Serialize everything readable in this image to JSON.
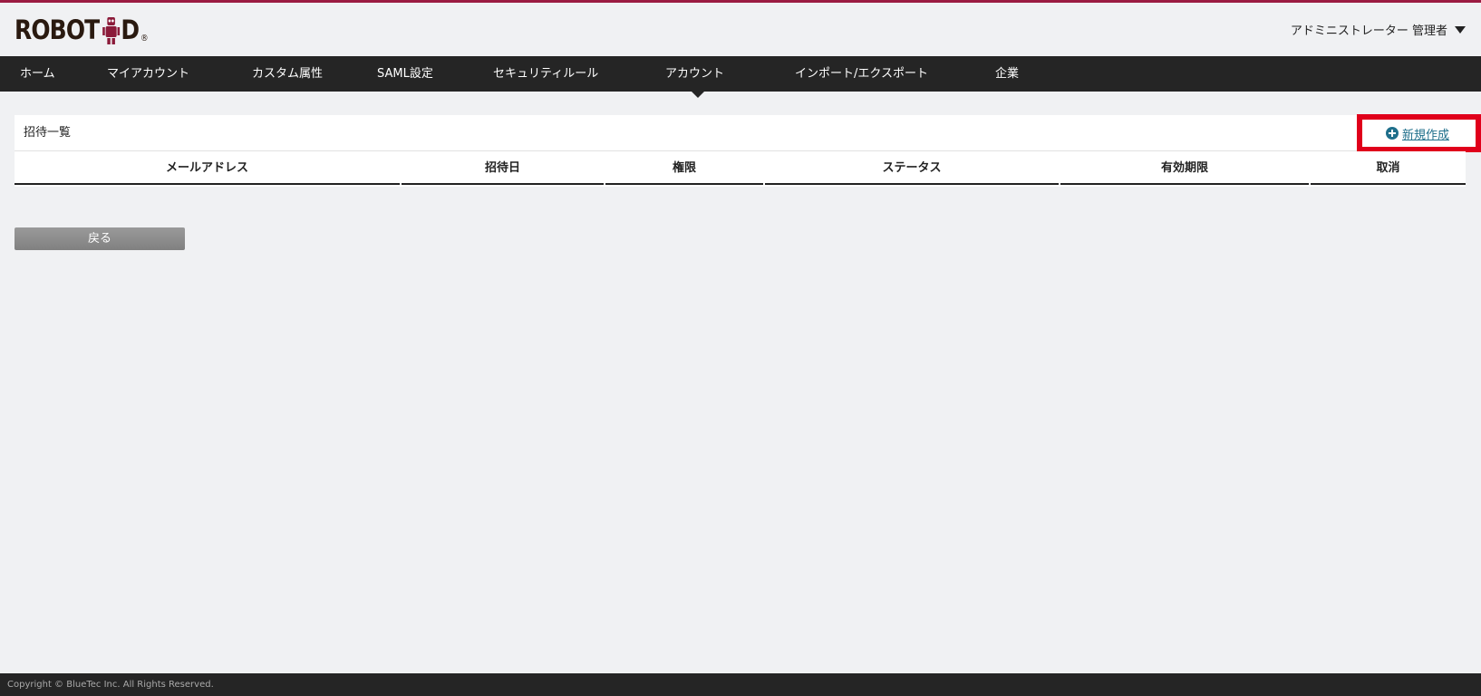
{
  "header": {
    "logo_text_left": "ROBOT",
    "logo_text_right": "D",
    "logo_reg": "®",
    "user_name": "アドミニストレーター 管理者"
  },
  "nav": {
    "items": [
      {
        "label": "ホーム"
      },
      {
        "label": "マイアカウント"
      },
      {
        "label": "カスタム属性"
      },
      {
        "label": "SAML設定"
      },
      {
        "label": "セキュリティルール"
      },
      {
        "label": "アカウント",
        "active": true
      },
      {
        "label": "インポート/エクスポート"
      },
      {
        "label": "企業"
      }
    ]
  },
  "panel": {
    "title": "招待一覧",
    "new_button_label": "新規作成"
  },
  "table": {
    "columns": [
      "メールアドレス",
      "招待日",
      "権限",
      "ステータス",
      "有効期限",
      "取消"
    ],
    "rows": []
  },
  "back_button_label": "戻る",
  "footer": {
    "copyright": "Copyright © BlueTec Inc. All Rights Reserved."
  },
  "colors": {
    "accent": "#9b1b42",
    "nav_bg": "#252525",
    "link": "#1f6f8b",
    "highlight": "#e0001b"
  },
  "icons": {
    "new_button": "plus-circle-icon",
    "user_menu": "caret-down-icon",
    "logo_figure": "robot-icon"
  }
}
